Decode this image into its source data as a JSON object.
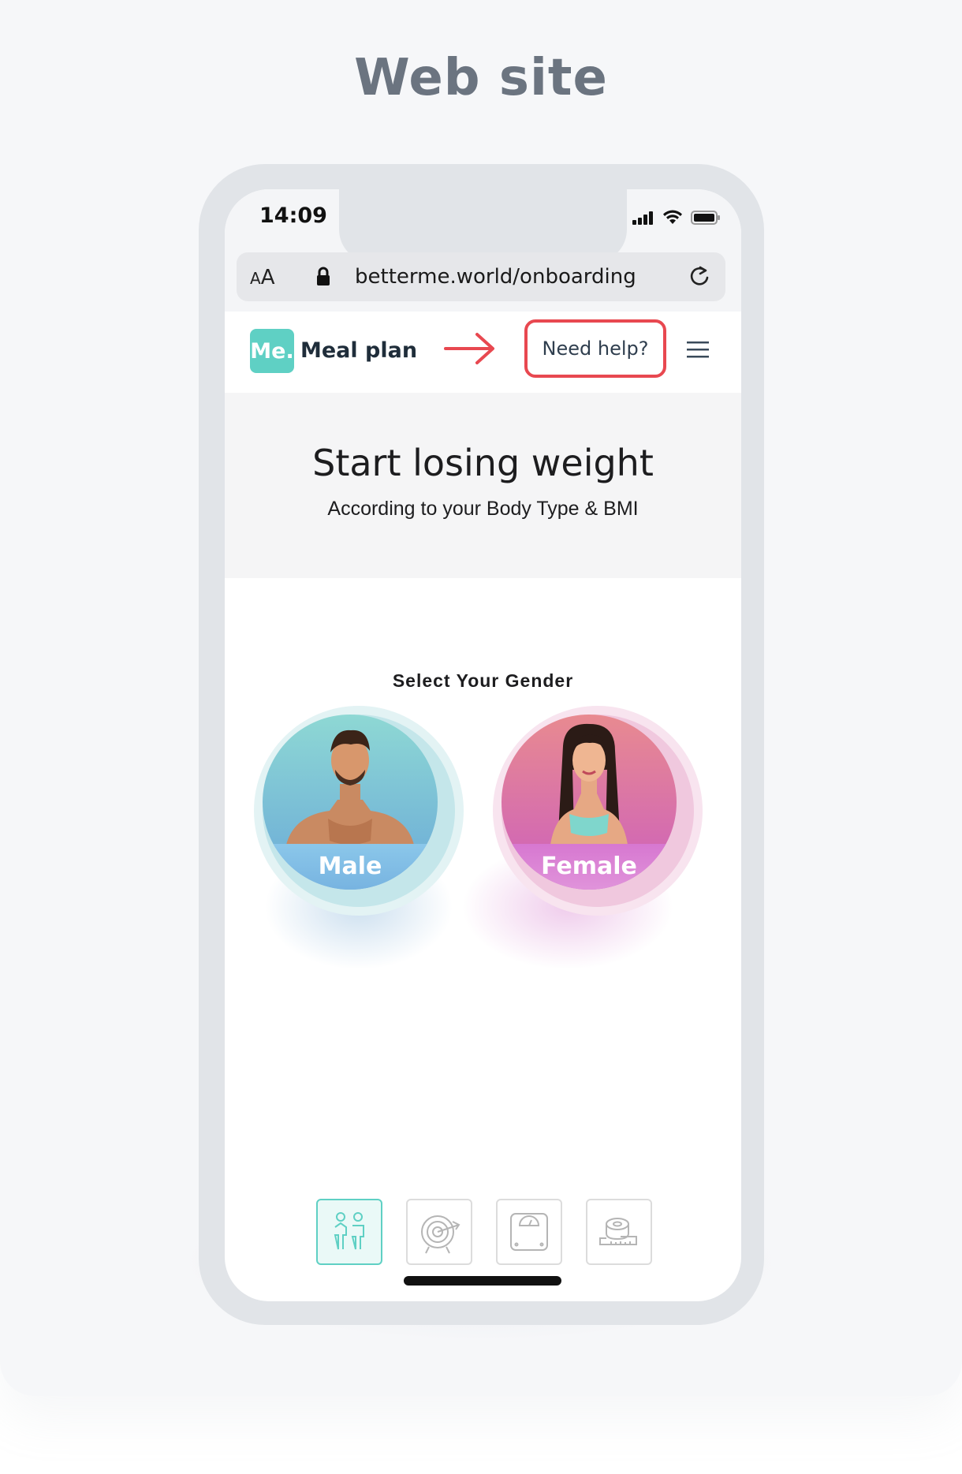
{
  "page": {
    "heading": "Web site"
  },
  "status_bar": {
    "time": "14:09"
  },
  "browser": {
    "text_size_label_small": "A",
    "text_size_label_large": "A",
    "url": "betterme.world/onboarding"
  },
  "navbar": {
    "logo_badge": "Me.",
    "logo_text": "Meal plan",
    "help_label": "Need help?"
  },
  "hero": {
    "title": "Start losing weight",
    "subtitle": "According to your Body Type & BMI"
  },
  "gender": {
    "prompt": "Select Your Gender",
    "options": [
      {
        "label": "Male",
        "colors": [
          "#8ed8d4",
          "#6aa9d8"
        ]
      },
      {
        "label": "Female",
        "colors": [
          "#e88a90",
          "#cc5fbd"
        ]
      }
    ]
  },
  "steps": [
    {
      "icon": "gender-icon",
      "active": true
    },
    {
      "icon": "target-icon",
      "active": false
    },
    {
      "icon": "scale-icon",
      "active": false
    },
    {
      "icon": "measuring-tape-icon",
      "active": false
    }
  ],
  "colors": {
    "accent": "#5fd0c4",
    "highlight": "#e84850"
  }
}
